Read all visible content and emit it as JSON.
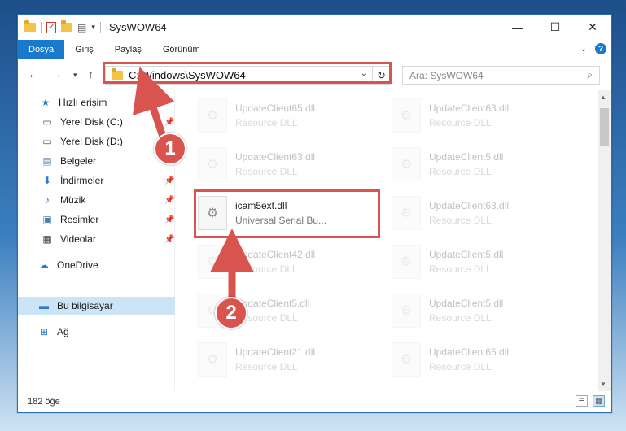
{
  "window": {
    "title": "SysWOW64",
    "controls": {
      "minimize": "—",
      "maximize": "☐",
      "close": "✕"
    }
  },
  "ribbon": {
    "tabs": [
      "Dosya",
      "Giriş",
      "Paylaş",
      "Görünüm"
    ],
    "active_tab": "Dosya",
    "help": "?"
  },
  "address": {
    "path": "C:\\Windows\\SysWOW64",
    "search_placeholder": "Ara: SysWOW64"
  },
  "sidebar": {
    "items": [
      {
        "label": "Hızlı erişim",
        "icon": "star-icon",
        "pinned": false
      },
      {
        "label": "Yerel Disk (C:)",
        "icon": "drive-icon",
        "pinned": true
      },
      {
        "label": "Yerel Disk (D:)",
        "icon": "drive-icon",
        "pinned": false
      },
      {
        "label": "Belgeler",
        "icon": "document-icon",
        "pinned": true
      },
      {
        "label": "İndirmeler",
        "icon": "download-icon",
        "pinned": true
      },
      {
        "label": "Müzik",
        "icon": "music-icon",
        "pinned": true
      },
      {
        "label": "Resimler",
        "icon": "picture-icon",
        "pinned": true
      },
      {
        "label": "Videolar",
        "icon": "video-icon",
        "pinned": true
      },
      {
        "label": "OneDrive",
        "icon": "cloud-icon",
        "pinned": false
      },
      {
        "label": "Bu bilgisayar",
        "icon": "computer-icon",
        "pinned": false,
        "selected": true
      },
      {
        "label": "Ağ",
        "icon": "network-icon",
        "pinned": false
      }
    ]
  },
  "files": [
    {
      "name": "UpdateClient65.dll",
      "desc": "Resource DLL",
      "faded": true
    },
    {
      "name": "UpdateClient63.dll",
      "desc": "Resource DLL",
      "faded": true
    },
    {
      "name": "UpdateClient63.dll",
      "desc": "Resource DLL",
      "faded": true
    },
    {
      "name": "UpdateClient5.dll",
      "desc": "Resource DLL",
      "faded": true
    },
    {
      "name": "icam5ext.dll",
      "desc": "Universal Serial Bu...",
      "faded": false
    },
    {
      "name": "UpdateClient63.dll",
      "desc": "Resource DLL",
      "faded": true
    },
    {
      "name": "UpdateClient42.dll",
      "desc": "Resource DLL",
      "faded": true
    },
    {
      "name": "UpdateClient5.dll",
      "desc": "Resource DLL",
      "faded": true
    },
    {
      "name": "UpdateClient5.dll",
      "desc": "Resource DLL",
      "faded": true
    },
    {
      "name": "UpdateClient5.dll",
      "desc": "Resource DLL",
      "faded": true
    },
    {
      "name": "UpdateClient21.dll",
      "desc": "Resource DLL",
      "faded": true
    },
    {
      "name": "UpdateClient65.dll",
      "desc": "Resource DLL",
      "faded": true
    }
  ],
  "status": {
    "item_count": "182 öğe"
  },
  "callouts": {
    "one": "1",
    "two": "2"
  },
  "colors": {
    "accent": "#1979ca",
    "highlight": "#d9534f",
    "selected": "#cce4f7"
  }
}
